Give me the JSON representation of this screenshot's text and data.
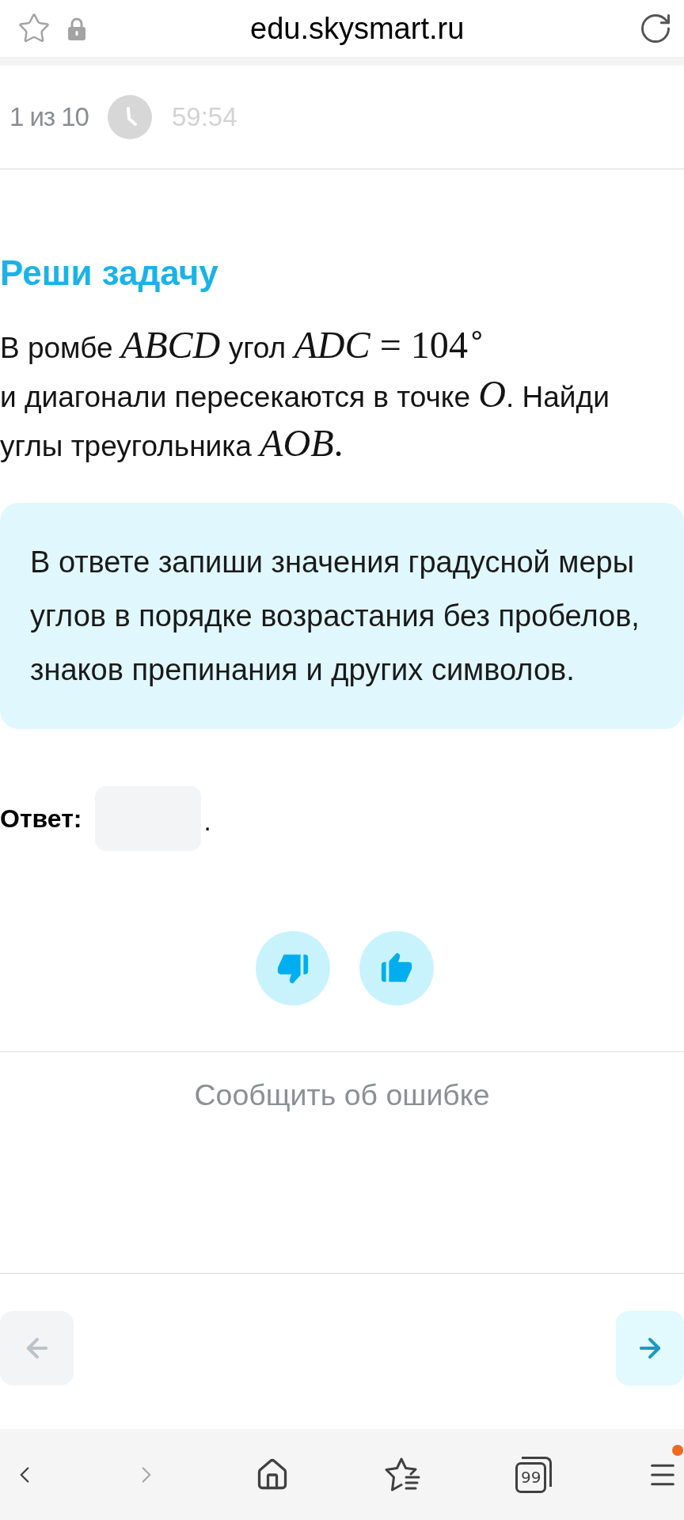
{
  "browser_bar": {
    "url": "edu.skysmart.ru"
  },
  "progress": {
    "counter": "1 из 10",
    "timer": "59:54"
  },
  "task": {
    "title": "Реши задачу",
    "problem": {
      "lines": [
        [
          {
            "kind": "text",
            "text": "В ромбе "
          },
          {
            "kind": "var",
            "text": "ABCD"
          },
          {
            "kind": "text",
            "text": " угол "
          },
          {
            "kind": "var",
            "text": "ADC"
          },
          {
            "kind": "math",
            "text": " = 104$^{∘}$"
          }
        ],
        [
          {
            "kind": "text",
            "text": "и диагонали пересекаются в точке "
          },
          {
            "kind": "var",
            "text": "O"
          },
          {
            "kind": "text",
            "text": ". Найди"
          }
        ],
        [
          {
            "kind": "text",
            "text": "углы треугольника "
          },
          {
            "kind": "var",
            "text": "AOB"
          },
          {
            "kind": "math",
            "text": "."
          }
        ]
      ]
    },
    "hint": {
      "lines": [
        "В ответе запиши значения градусной меры",
        "углов в порядке возрастания без пробелов,",
        "знаков препинания и других символов."
      ]
    },
    "answer": {
      "label": "Ответ:",
      "suffix": "."
    }
  },
  "feedback": {
    "buttons": [
      {
        "kind": "dislike"
      },
      {
        "kind": "like"
      }
    ]
  },
  "report_link": "Сообщить об ошибке",
  "navigation": {
    "prev": {
      "disabled": true
    },
    "next": {
      "disabled": false
    }
  },
  "bottom_bar": {
    "forward_disabled": true,
    "tab_count": "99",
    "menu_notification": true
  }
}
